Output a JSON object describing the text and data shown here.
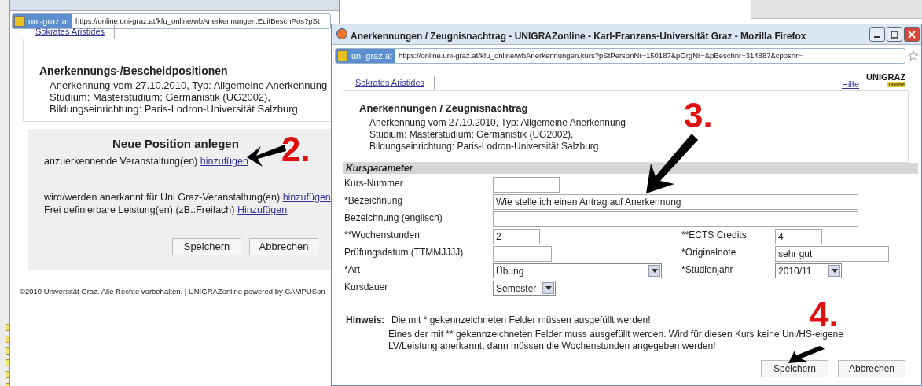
{
  "background_window": {
    "site_badge": "uni-graz.at",
    "url": "https://online.uni-graz.at/kfu_online/wbAnerkennungen.EditBeschPos?pSt",
    "tab": "Sokrates Aristides",
    "heading": "Anerkennungs-/Bescheidpositionen",
    "details": [
      "Anerkennung vom 27.10.2010, Typ: Allgemeine Anerkennung",
      "Studium: Masterstudium; Germanistik (UG2002),",
      "Bildungseinrichtung: Paris-Lodron-Universität Salzburg"
    ],
    "panel": {
      "title": "Neue Position anlegen",
      "lines": [
        {
          "text": "anzuerkennende Veranstaltung(en)",
          "link": "hinzufügen"
        },
        {
          "text": "wird/werden anerkannt für Uni Graz-Veranstaltung(en)",
          "link": "hinzufügen"
        },
        {
          "text": "Frei definierbare Leistung(en) (zB.:Freifach)",
          "link": "Hinzufügen"
        }
      ],
      "buttons": [
        "Speichern",
        "Abbrechen"
      ]
    },
    "footer": "©2010 Universität Graz. Alle Rechte vorbehalten. | UNIGRAZonline powered by CAMPUSon"
  },
  "main_window": {
    "title": "Anerkennungen / Zeugnisnachtrag - UNIGRAZonline - Karl-Franzens-Universität Graz - Mozilla Firefox",
    "site_badge": "uni-graz.at",
    "url": "https://online.uni-graz.at/kfu_online/wbAnerkennungen.kurs?pStPersonNr=150187&pOrgNr=&pBeschnr=314887&cposnr=",
    "tab": "Sokrates Aristides",
    "help_link": "Hilfe",
    "logo": {
      "text": "UNIGRAZ",
      "sub": "online"
    },
    "heading": "Anerkennungen / Zeugnisnachtrag",
    "details": [
      "Anerkennung vom 27.10.2010, Typ: Allgemeine Anerkennung",
      "Studium: Masterstudium; Germanistik (UG2002),",
      "Bildungseinrichtung: Paris-Lodron-Universität Salzburg"
    ],
    "section_title": "Kursparameter",
    "rows": [
      {
        "left": {
          "label": "Kurs-Nummer",
          "kind": "text"
        }
      },
      {
        "left": {
          "label": "*Bezeichnung",
          "kind": "text",
          "value": "Wie stelle ich einen Antrag auf Anerkennung"
        }
      },
      {
        "left": {
          "label": "Bezeichnung (englisch)",
          "kind": "text"
        }
      },
      {
        "left": {
          "label": "**Wochenstunden",
          "kind": "text",
          "value": "2"
        },
        "right": {
          "label": "**ECTS Credits",
          "kind": "text",
          "value": "4"
        }
      },
      {
        "left": {
          "label": "Prüfungsdatum (TTMMJJJJ)",
          "kind": "text"
        },
        "right": {
          "label": "*Originalnote",
          "kind": "text",
          "value": "sehr gut"
        }
      },
      {
        "left": {
          "label": "*Art",
          "kind": "select",
          "value": "Übung"
        },
        "right": {
          "label": "*Studienjahr",
          "kind": "select",
          "value": "2010/11"
        }
      },
      {
        "left": {
          "label": "Kursdauer",
          "kind": "select",
          "value": "Semester"
        }
      }
    ],
    "note": {
      "label": "Hinweis:",
      "lines": [
        "Die mit * gekennzeichneten Felder müssen ausgefüllt werden!",
        "Eines der mit ** gekennzeichneten Felder muss ausgefüllt werden. Wird für diesen Kurs keine Uni/HS-eigene",
        "LV/Leistung anerkannt, dann müssen die Wochenstunden angegeben werden!"
      ]
    },
    "buttons": [
      "Speichern",
      "Abbrechen"
    ]
  },
  "annotations": [
    {
      "label": "2."
    },
    {
      "label": "3."
    },
    {
      "label": "4."
    }
  ]
}
